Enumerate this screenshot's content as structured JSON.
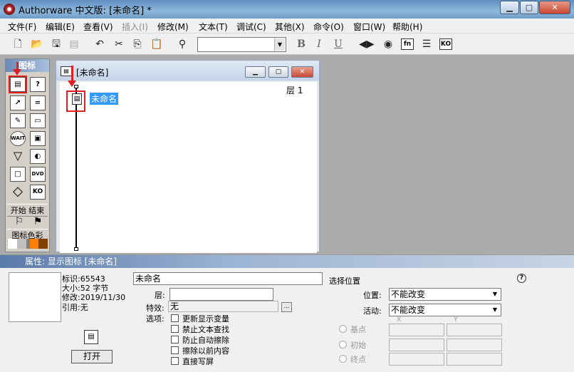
{
  "window": {
    "title": "Authorware 中文版: [未命名] *"
  },
  "menu": [
    "文件(F)",
    "编辑(E)",
    "查看(V)",
    "插入(I)",
    "修改(M)",
    "文本(T)",
    "调试(C)",
    "其他(X)",
    "命令(O)",
    "窗口(W)",
    "帮助(H)"
  ],
  "toolbar": {
    "bold": "B",
    "italic": "I",
    "underline": "U",
    "btn_fn": "fn",
    "btn_ko": "KO"
  },
  "palette": {
    "title": "图标",
    "start_label": "开始",
    "end_label": "结束",
    "color_label": "图标色彩",
    "icons": [
      {
        "name": "display-icon",
        "glyph": "▤"
      },
      {
        "name": "motion-icon",
        "glyph": "◇"
      },
      {
        "name": "erase-icon",
        "glyph": "✎"
      },
      {
        "name": "wait-icon",
        "glyph": "WAIT"
      },
      {
        "name": "navigate-icon",
        "glyph": "▽"
      },
      {
        "name": "framework-icon",
        "glyph": "□"
      },
      {
        "name": "decision-icon",
        "glyph": "◇"
      },
      {
        "name": "interaction-icon",
        "glyph": "?"
      },
      {
        "name": "calculate-icon",
        "glyph": "="
      },
      {
        "name": "map-icon",
        "glyph": "▭"
      },
      {
        "name": "digital-movie-icon",
        "glyph": "▣"
      },
      {
        "name": "sound-icon",
        "glyph": "◐"
      },
      {
        "name": "video-icon",
        "glyph": "DVD"
      },
      {
        "name": "knowledge-object-icon",
        "glyph": "KO"
      }
    ],
    "colors": [
      "#ffffff",
      "#c0c0c0",
      "#808080",
      "#ff8000",
      "#804000"
    ]
  },
  "flow_window": {
    "title": "[未命名]",
    "layer_label": "层 1",
    "node_label": "未命名"
  },
  "props": {
    "title": "属性: 显示图标 [未命名]",
    "id_label": "标识:65543",
    "size_label": "大小:52 字节",
    "modified_label": "修改:2019/11/30",
    "ref_label": "引用:无",
    "name_value": "未命名",
    "layer_label": "层:",
    "layer_value": "",
    "effect_label": "特效:",
    "effect_value": "无",
    "effect_button": "...",
    "options_label": "选项:",
    "options": [
      "更新显示变量",
      "禁止文本查找",
      "防止自动擦除",
      "擦除以前内容",
      "直接写屏"
    ],
    "open_button": "打开",
    "select_position_label": "选择位置",
    "position_label": "位置:",
    "position_value": "不能改变",
    "active_label": "活动:",
    "active_value": "不能改变",
    "base_label": "基点",
    "init_label": "初始",
    "end_label": "终点",
    "x_header": "X",
    "y_header": "Y",
    "help": "?"
  }
}
